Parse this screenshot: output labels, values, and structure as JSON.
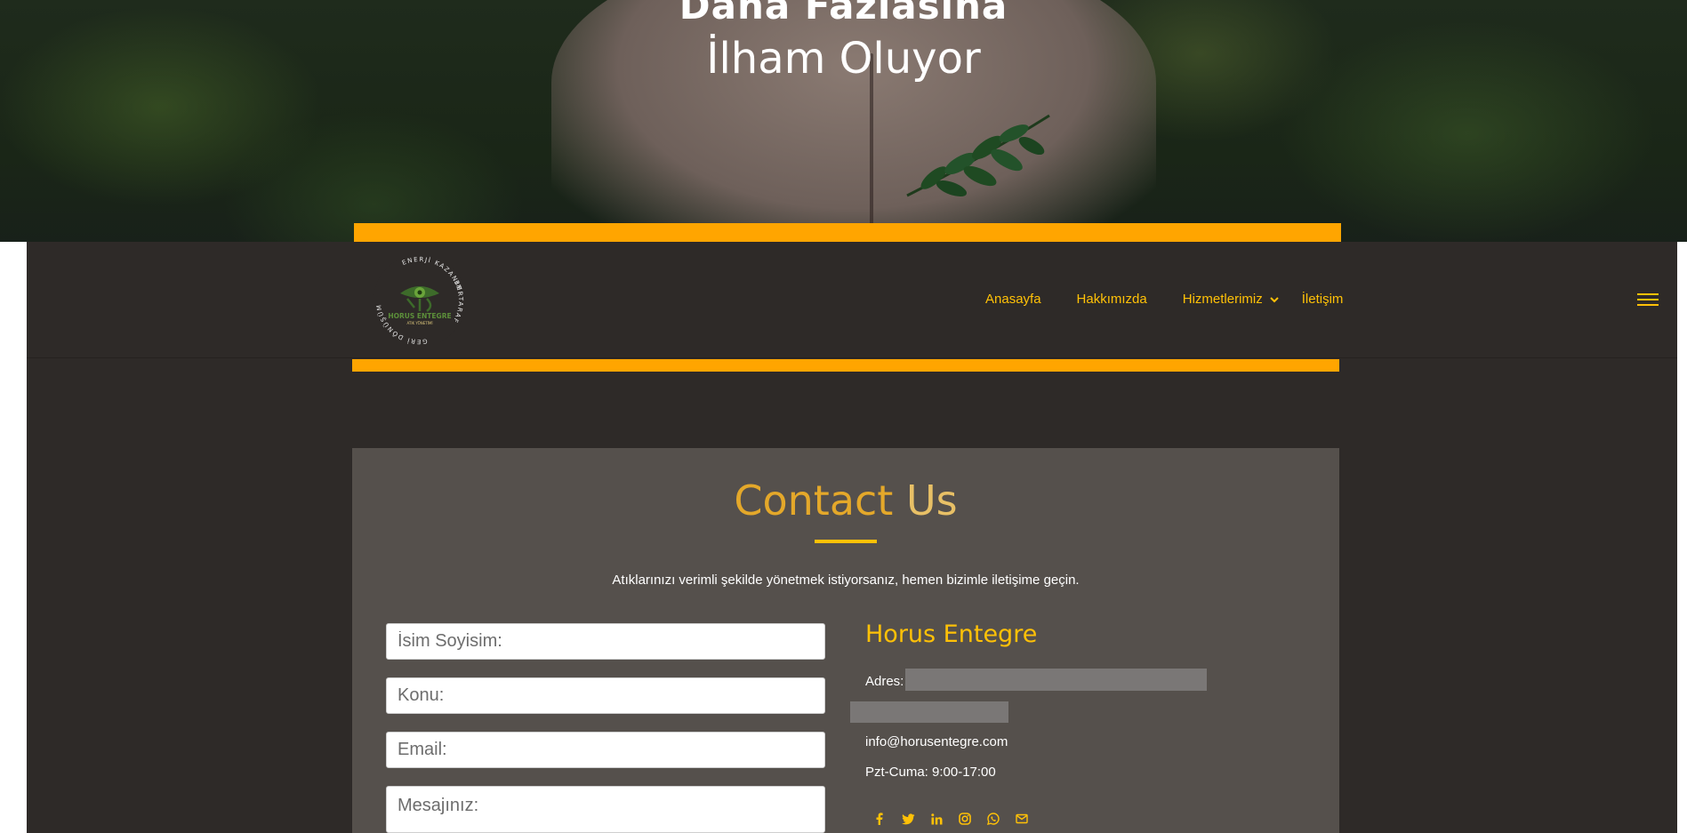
{
  "hero": {
    "title_line1": "Daha Fazlasına",
    "title_line2": "İlham Oluyor"
  },
  "nav": {
    "items": [
      {
        "label": "Anasayfa"
      },
      {
        "label": "Hakkımızda"
      },
      {
        "label": "Hizmetlerimiz"
      },
      {
        "label": "İletişim"
      }
    ]
  },
  "logo": {
    "ring_top": "ENERJİ KAZANIMI",
    "ring_left": "GERİ DÖNÜŞÜM",
    "ring_right": "BERTARAF",
    "name": "HORUS ENTEGRE",
    "tagline": "ATIK YÖNETİMİ"
  },
  "contact": {
    "title_word1": "Contact",
    "title_word2": "Us",
    "description": "Atıklarınızı verimli şekilde yönetmek istiyorsanız, hemen bizimle iletişime geçin.",
    "form": {
      "name_placeholder": "İsim Soyisim:",
      "subject_placeholder": "Konu:",
      "email_placeholder": "Email:",
      "message_placeholder": "Mesajınız:"
    },
    "info": {
      "company": "Horus Entegre",
      "address_label": "Adres:",
      "email": "info@horusentegre.com",
      "hours": "Pzt-Cuma: 9:00-17:00"
    },
    "socials": [
      "facebook-icon",
      "twitter-icon",
      "linkedin-icon",
      "instagram-icon",
      "whatsapp-icon",
      "mail-icon"
    ]
  },
  "colors": {
    "accent": "#ffc107",
    "orange_bar": "#ffa500",
    "page_bg": "#2e2a28",
    "contact_bg": "#55504c"
  }
}
